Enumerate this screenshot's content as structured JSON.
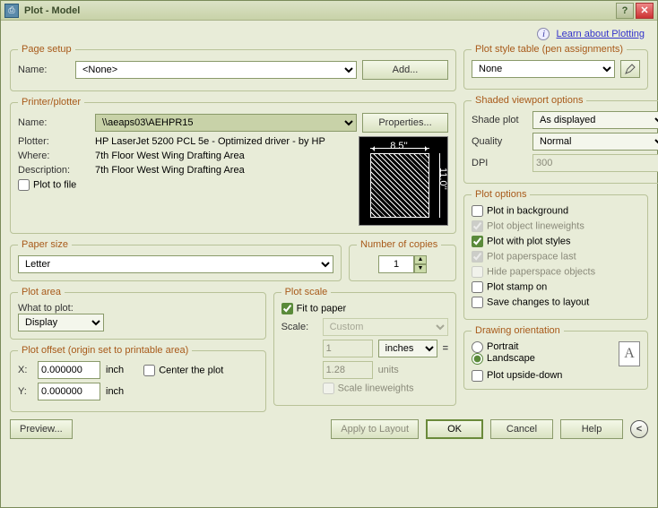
{
  "window": {
    "title": "Plot - Model"
  },
  "learn_link": "Learn about Plotting",
  "page_setup": {
    "legend": "Page setup",
    "name_label": "Name:",
    "name_value": "<None>",
    "add_btn": "Add..."
  },
  "printer": {
    "legend": "Printer/plotter",
    "name_label": "Name:",
    "name_value": "\\\\aeaps03\\AEHPR15",
    "props_btn": "Properties...",
    "plotter_label": "Plotter:",
    "plotter_value": "HP LaserJet 5200 PCL 5e - Optimized driver - by HP",
    "where_label": "Where:",
    "where_value": "7th Floor West Wing Drafting Area",
    "desc_label": "Description:",
    "desc_value": "7th Floor West Wing Drafting Area",
    "plot_to_file": "Plot to file",
    "page_w": "8.5''",
    "page_h": "11.0''"
  },
  "paper": {
    "legend": "Paper size",
    "value": "Letter"
  },
  "copies": {
    "legend": "Number of copies",
    "value": "1"
  },
  "area": {
    "legend": "Plot area",
    "what_label": "What to plot:",
    "value": "Display"
  },
  "scale": {
    "legend": "Plot scale",
    "fit": "Fit to paper",
    "scale_label": "Scale:",
    "scale_value": "Custom",
    "units_num": "1",
    "units_unit": "inches",
    "drawing_num": "1.28",
    "drawing_unit": "units",
    "scale_lw": "Scale lineweights"
  },
  "offset": {
    "legend": "Plot offset (origin set to printable area)",
    "x_label": "X:",
    "x_value": "0.000000",
    "x_unit": "inch",
    "y_label": "Y:",
    "y_value": "0.000000",
    "y_unit": "inch",
    "center": "Center the plot"
  },
  "styletable": {
    "legend": "Plot style table (pen assignments)",
    "value": "None"
  },
  "shaded": {
    "legend": "Shaded viewport options",
    "shade_label": "Shade plot",
    "shade_value": "As displayed",
    "quality_label": "Quality",
    "quality_value": "Normal",
    "dpi_label": "DPI",
    "dpi_value": "300"
  },
  "options": {
    "legend": "Plot options",
    "bg": "Plot in background",
    "lw": "Plot object lineweights",
    "styles": "Plot with plot styles",
    "paperspace": "Plot paperspace last",
    "hide": "Hide paperspace objects",
    "stamp": "Plot stamp on",
    "save": "Save changes to layout"
  },
  "orient": {
    "legend": "Drawing orientation",
    "portrait": "Portrait",
    "landscape": "Landscape",
    "upside": "Plot upside-down"
  },
  "buttons": {
    "preview": "Preview...",
    "apply": "Apply to Layout",
    "ok": "OK",
    "cancel": "Cancel",
    "help": "Help"
  }
}
